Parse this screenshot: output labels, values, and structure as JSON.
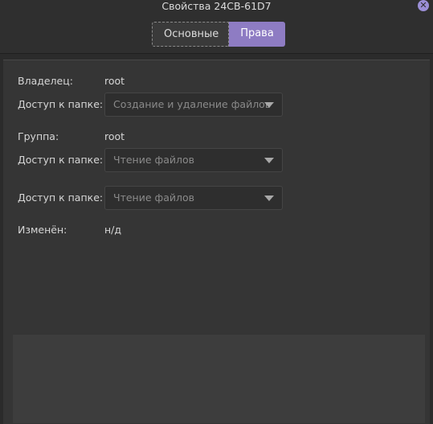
{
  "window": {
    "title": "Свойства 24CB-61D7",
    "close_icon": "close-icon"
  },
  "tabs": [
    {
      "label": "Основные",
      "active": false
    },
    {
      "label": "Права",
      "active": true
    }
  ],
  "permissions": {
    "owner_label": "Владелец:",
    "owner_value": "root",
    "owner_access_label": "Доступ к папке:",
    "owner_access_value": "Создание и удаление файлов",
    "group_label": "Группа:",
    "group_value": "root",
    "group_access_label": "Доступ к папке:",
    "group_access_value": "Чтение файлов",
    "others_access_label": "Доступ к папке:",
    "others_access_value": "Чтение файлов",
    "modified_label": "Изменён:",
    "modified_value": "н/д"
  },
  "colors": {
    "accent": "#8e7cc3",
    "background": "#2b2b2b",
    "panel": "#353535"
  }
}
